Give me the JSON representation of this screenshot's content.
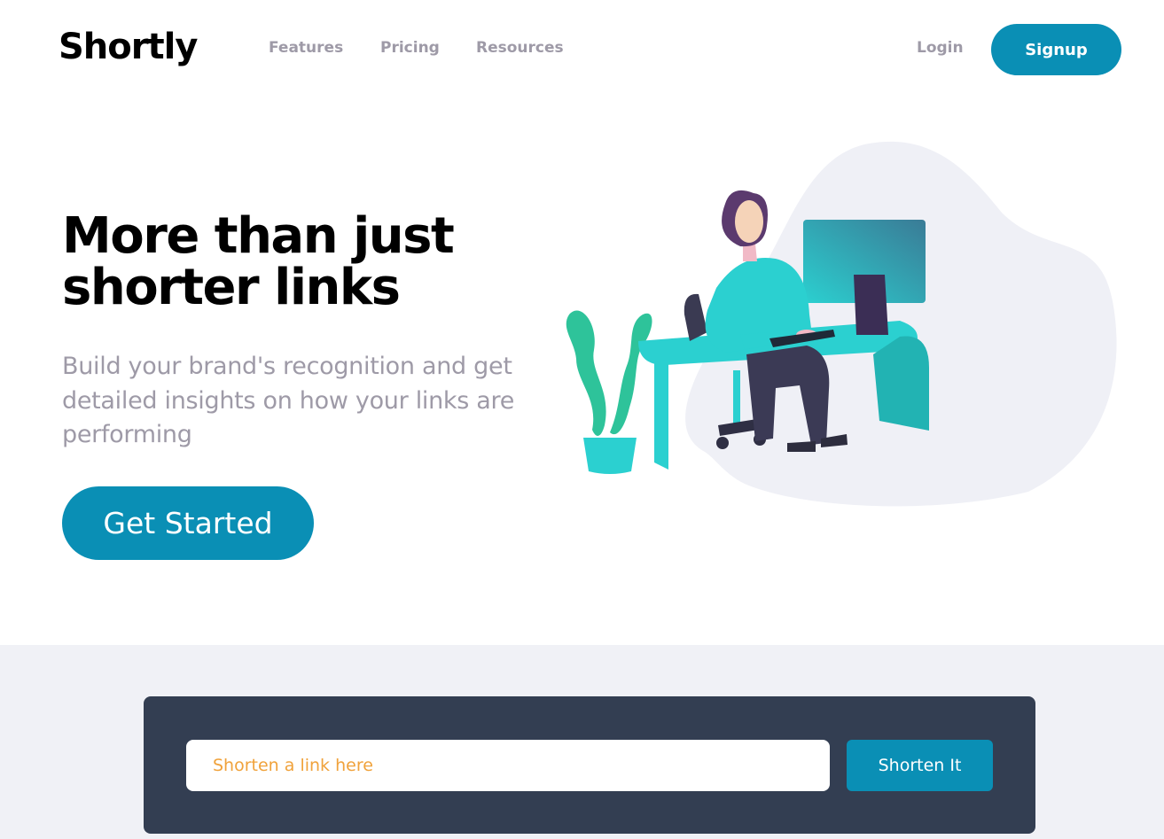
{
  "brand": {
    "name": "Shortly"
  },
  "nav": {
    "links": [
      {
        "label": "Features"
      },
      {
        "label": "Pricing"
      },
      {
        "label": "Resources"
      }
    ],
    "login_label": "Login",
    "signup_label": "Signup"
  },
  "hero": {
    "title": "More than just shorter links",
    "subtitle": "Build your brand's recognition and get detailed insights on how your links are performing",
    "cta_label": "Get Started"
  },
  "shorten": {
    "placeholder": "Shorten a link here",
    "button_label": "Shorten It"
  },
  "colors": {
    "primary": "#0a8fb5",
    "dark_panel": "#333e52",
    "muted_text": "#9e9aa7",
    "band_bg": "#f0f1f6",
    "placeholder": "#f0a23b"
  },
  "icons": {
    "illustration": "person-working-at-desk-illustration"
  }
}
